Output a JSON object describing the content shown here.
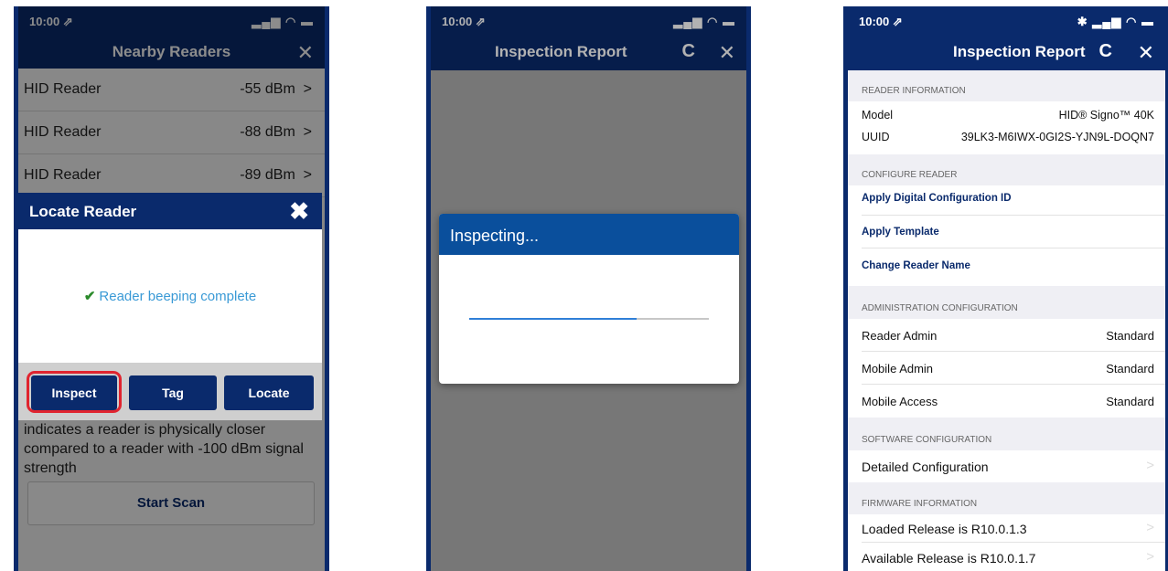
{
  "screen1": {
    "status_time": "10:00 ⇗",
    "status_icons": "▂▄▆ ◠ ▬",
    "title": "Nearby Readers",
    "close_icon": "✕",
    "readers": [
      {
        "name": "HID Reader",
        "signal": "-55 dBm"
      },
      {
        "name": "HID Reader",
        "signal": "-88 dBm"
      },
      {
        "name": "HID Reader",
        "signal": "-89 dBm"
      }
    ],
    "chevron": ">",
    "help_text": "indicates a reader is physically closer compared to a reader with -100 dBm signal strength",
    "start_scan": "Start Scan",
    "modal": {
      "title": "Locate Reader",
      "close": "✖",
      "check": "✔",
      "message": "Reader beeping complete",
      "buttons": [
        "Inspect",
        "Tag",
        "Locate"
      ]
    }
  },
  "screen2": {
    "status_time": "10:00 ⇗",
    "status_icons": "▂▄▆ ◠ ▬",
    "title": "Inspection Report",
    "refresh_icon": "C",
    "close_icon": "✕",
    "modal_title": "Inspecting...",
    "progress": 0.7
  },
  "screen3": {
    "status_time": "10:00 ⇗",
    "status_icons": "✱ ▂▄▆ ◠ ▬",
    "title": "Inspection Report",
    "refresh_icon": "C",
    "close_icon": "✕",
    "reader_info": {
      "header": "READER INFORMATION",
      "model_label": "Model",
      "model_value": "HID® Signo™ 40K",
      "uuid_label": "UUID",
      "uuid_value": "39LK3-M6IWX-0GI2S-YJN9L-DOQN7"
    },
    "configure": {
      "header": "CONFIGURE READER",
      "links": [
        "Apply Digital Configuration ID",
        "Apply Template",
        "Change Reader Name"
      ]
    },
    "admin": {
      "header": "ADMINISTRATION CONFIGURATION",
      "rows": [
        {
          "label": "Reader Admin",
          "value": "Standard"
        },
        {
          "label": "Mobile Admin",
          "value": "Standard"
        },
        {
          "label": "Mobile Access",
          "value": "Standard"
        }
      ]
    },
    "software": {
      "header": "SOFTWARE CONFIGURATION",
      "row": "Detailed Configuration"
    },
    "firmware": {
      "header": "FIRMWARE INFORMATION",
      "rows": [
        "Loaded Release is R10.0.1.3",
        "Available Release is R10.0.1.7"
      ]
    },
    "chevron": ">"
  }
}
